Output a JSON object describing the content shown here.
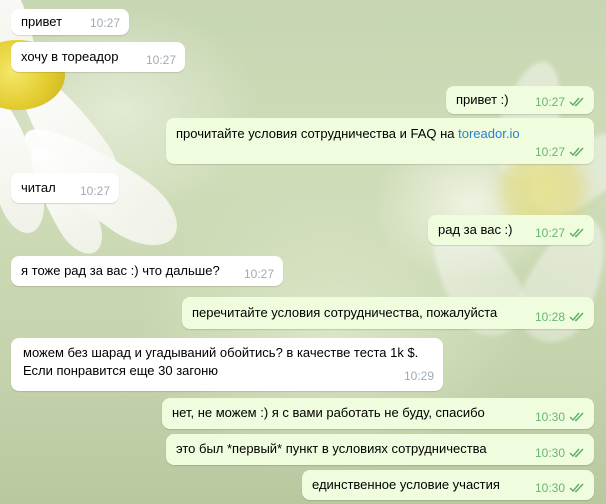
{
  "colors": {
    "incoming_bubble": "#ffffff",
    "outgoing_bubble": "#effdde",
    "incoming_time": "#a0acb6",
    "outgoing_time": "#6bb572",
    "link": "#2481cc"
  },
  "messages": [
    {
      "dir": "in",
      "text": "привет",
      "time": "10:27"
    },
    {
      "dir": "in",
      "text": "хочу в тореадор",
      "time": "10:27"
    },
    {
      "dir": "out",
      "text": "привет :)",
      "time": "10:27",
      "status": "double-check-icon"
    },
    {
      "dir": "out",
      "text": "прочитайте условия сотрудничества и FAQ на ",
      "link": "toreador.io",
      "time": "10:27",
      "status": "double-check-icon"
    },
    {
      "dir": "in",
      "text": "читал",
      "time": "10:27"
    },
    {
      "dir": "out",
      "text": "рад за вас :)",
      "time": "10:27",
      "status": "double-check-icon"
    },
    {
      "dir": "in",
      "text": "я тоже рад за вас :) что дальше?",
      "time": "10:27"
    },
    {
      "dir": "out",
      "text": "перечитайте условия сотрудничества, пожалуйста",
      "time": "10:28",
      "status": "double-check-icon"
    },
    {
      "dir": "in",
      "text": "можем без шарад и угадываний обойтись? в качестве теста 1k $. Если понравится еще 30 загоню",
      "time": "10:29"
    },
    {
      "dir": "out",
      "text": "нет, не можем :) я с вами работать не буду, спасибо",
      "time": "10:30",
      "status": "double-check-icon"
    },
    {
      "dir": "out",
      "text": "это был *первый* пункт в условиях сотрудничества",
      "time": "10:30",
      "status": "double-check-icon"
    },
    {
      "dir": "out",
      "text": "единственное условие участия",
      "time": "10:30",
      "status": "double-check-icon"
    }
  ]
}
